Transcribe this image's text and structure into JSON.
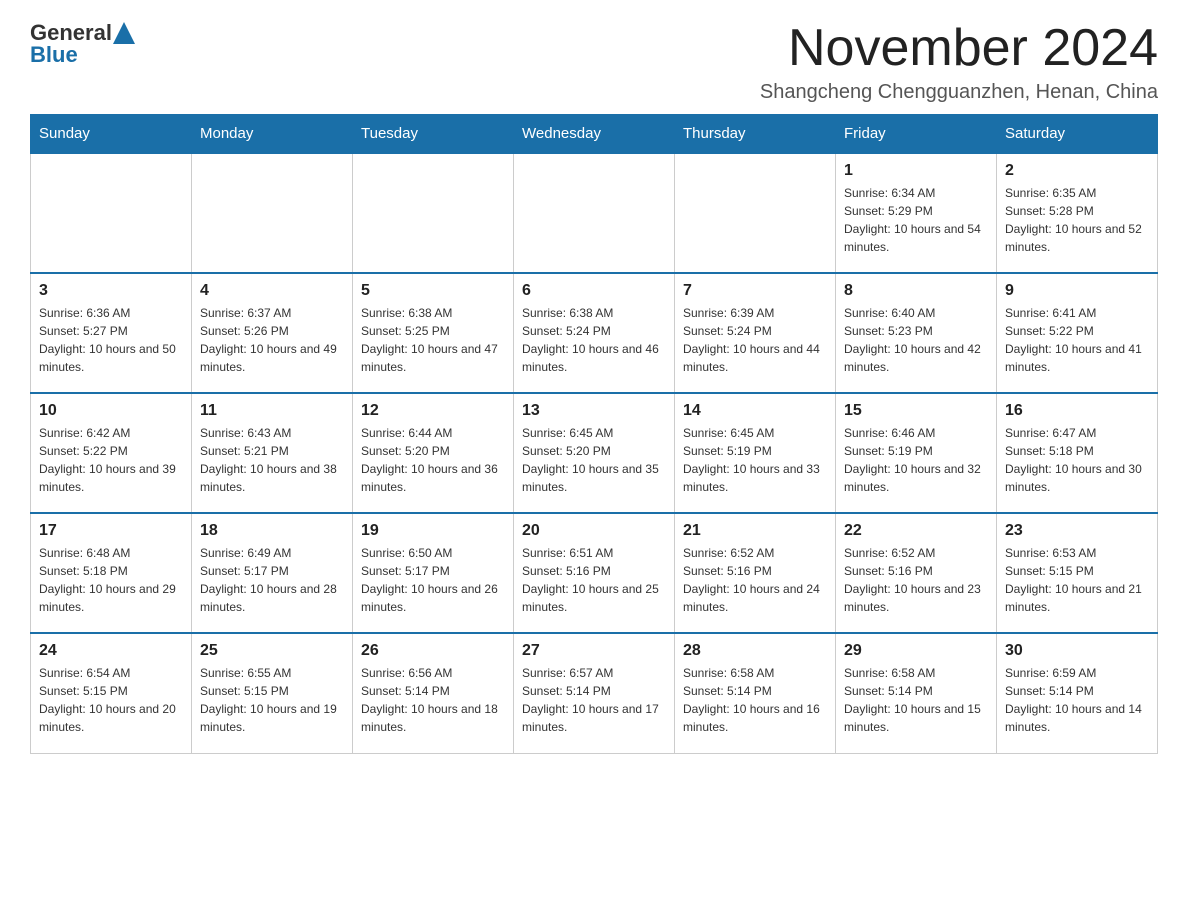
{
  "header": {
    "logo_general": "General",
    "logo_blue": "Blue",
    "month_title": "November 2024",
    "location": "Shangcheng Chengguanzhen, Henan, China"
  },
  "weekdays": [
    "Sunday",
    "Monday",
    "Tuesday",
    "Wednesday",
    "Thursday",
    "Friday",
    "Saturday"
  ],
  "weeks": [
    [
      {
        "day": "",
        "info": ""
      },
      {
        "day": "",
        "info": ""
      },
      {
        "day": "",
        "info": ""
      },
      {
        "day": "",
        "info": ""
      },
      {
        "day": "",
        "info": ""
      },
      {
        "day": "1",
        "info": "Sunrise: 6:34 AM\nSunset: 5:29 PM\nDaylight: 10 hours and 54 minutes."
      },
      {
        "day": "2",
        "info": "Sunrise: 6:35 AM\nSunset: 5:28 PM\nDaylight: 10 hours and 52 minutes."
      }
    ],
    [
      {
        "day": "3",
        "info": "Sunrise: 6:36 AM\nSunset: 5:27 PM\nDaylight: 10 hours and 50 minutes."
      },
      {
        "day": "4",
        "info": "Sunrise: 6:37 AM\nSunset: 5:26 PM\nDaylight: 10 hours and 49 minutes."
      },
      {
        "day": "5",
        "info": "Sunrise: 6:38 AM\nSunset: 5:25 PM\nDaylight: 10 hours and 47 minutes."
      },
      {
        "day": "6",
        "info": "Sunrise: 6:38 AM\nSunset: 5:24 PM\nDaylight: 10 hours and 46 minutes."
      },
      {
        "day": "7",
        "info": "Sunrise: 6:39 AM\nSunset: 5:24 PM\nDaylight: 10 hours and 44 minutes."
      },
      {
        "day": "8",
        "info": "Sunrise: 6:40 AM\nSunset: 5:23 PM\nDaylight: 10 hours and 42 minutes."
      },
      {
        "day": "9",
        "info": "Sunrise: 6:41 AM\nSunset: 5:22 PM\nDaylight: 10 hours and 41 minutes."
      }
    ],
    [
      {
        "day": "10",
        "info": "Sunrise: 6:42 AM\nSunset: 5:22 PM\nDaylight: 10 hours and 39 minutes."
      },
      {
        "day": "11",
        "info": "Sunrise: 6:43 AM\nSunset: 5:21 PM\nDaylight: 10 hours and 38 minutes."
      },
      {
        "day": "12",
        "info": "Sunrise: 6:44 AM\nSunset: 5:20 PM\nDaylight: 10 hours and 36 minutes."
      },
      {
        "day": "13",
        "info": "Sunrise: 6:45 AM\nSunset: 5:20 PM\nDaylight: 10 hours and 35 minutes."
      },
      {
        "day": "14",
        "info": "Sunrise: 6:45 AM\nSunset: 5:19 PM\nDaylight: 10 hours and 33 minutes."
      },
      {
        "day": "15",
        "info": "Sunrise: 6:46 AM\nSunset: 5:19 PM\nDaylight: 10 hours and 32 minutes."
      },
      {
        "day": "16",
        "info": "Sunrise: 6:47 AM\nSunset: 5:18 PM\nDaylight: 10 hours and 30 minutes."
      }
    ],
    [
      {
        "day": "17",
        "info": "Sunrise: 6:48 AM\nSunset: 5:18 PM\nDaylight: 10 hours and 29 minutes."
      },
      {
        "day": "18",
        "info": "Sunrise: 6:49 AM\nSunset: 5:17 PM\nDaylight: 10 hours and 28 minutes."
      },
      {
        "day": "19",
        "info": "Sunrise: 6:50 AM\nSunset: 5:17 PM\nDaylight: 10 hours and 26 minutes."
      },
      {
        "day": "20",
        "info": "Sunrise: 6:51 AM\nSunset: 5:16 PM\nDaylight: 10 hours and 25 minutes."
      },
      {
        "day": "21",
        "info": "Sunrise: 6:52 AM\nSunset: 5:16 PM\nDaylight: 10 hours and 24 minutes."
      },
      {
        "day": "22",
        "info": "Sunrise: 6:52 AM\nSunset: 5:16 PM\nDaylight: 10 hours and 23 minutes."
      },
      {
        "day": "23",
        "info": "Sunrise: 6:53 AM\nSunset: 5:15 PM\nDaylight: 10 hours and 21 minutes."
      }
    ],
    [
      {
        "day": "24",
        "info": "Sunrise: 6:54 AM\nSunset: 5:15 PM\nDaylight: 10 hours and 20 minutes."
      },
      {
        "day": "25",
        "info": "Sunrise: 6:55 AM\nSunset: 5:15 PM\nDaylight: 10 hours and 19 minutes."
      },
      {
        "day": "26",
        "info": "Sunrise: 6:56 AM\nSunset: 5:14 PM\nDaylight: 10 hours and 18 minutes."
      },
      {
        "day": "27",
        "info": "Sunrise: 6:57 AM\nSunset: 5:14 PM\nDaylight: 10 hours and 17 minutes."
      },
      {
        "day": "28",
        "info": "Sunrise: 6:58 AM\nSunset: 5:14 PM\nDaylight: 10 hours and 16 minutes."
      },
      {
        "day": "29",
        "info": "Sunrise: 6:58 AM\nSunset: 5:14 PM\nDaylight: 10 hours and 15 minutes."
      },
      {
        "day": "30",
        "info": "Sunrise: 6:59 AM\nSunset: 5:14 PM\nDaylight: 10 hours and 14 minutes."
      }
    ]
  ]
}
